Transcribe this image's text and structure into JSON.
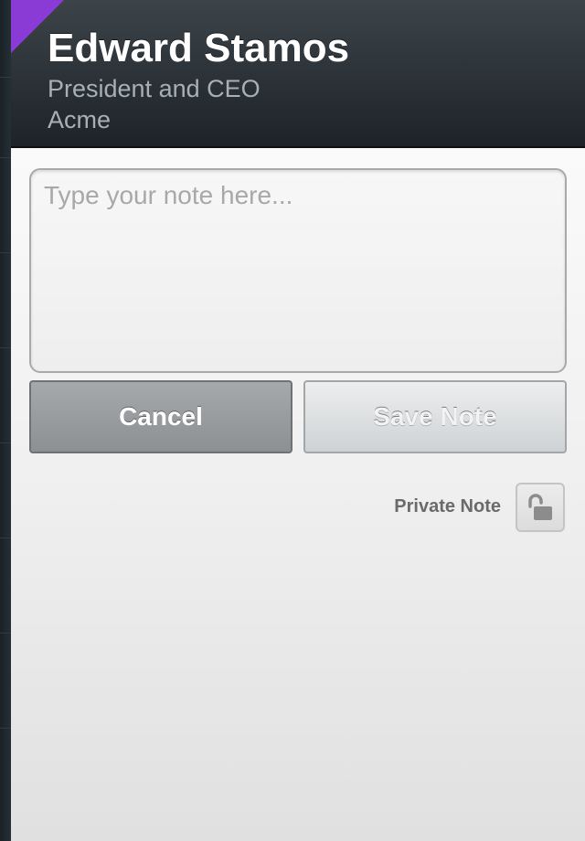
{
  "contact": {
    "name": "Edward Stamos",
    "title": "President and CEO",
    "company": "Acme"
  },
  "note": {
    "placeholder": "Type your note here...",
    "value": ""
  },
  "actions": {
    "cancel_label": "Cancel",
    "save_label": "Save Note"
  },
  "privacy": {
    "label": "Private Note",
    "icon": "unlocked-padlock-icon",
    "locked": false
  },
  "colors": {
    "accent_flag": "#8a3bd6",
    "header_bg": "#2b3237"
  }
}
